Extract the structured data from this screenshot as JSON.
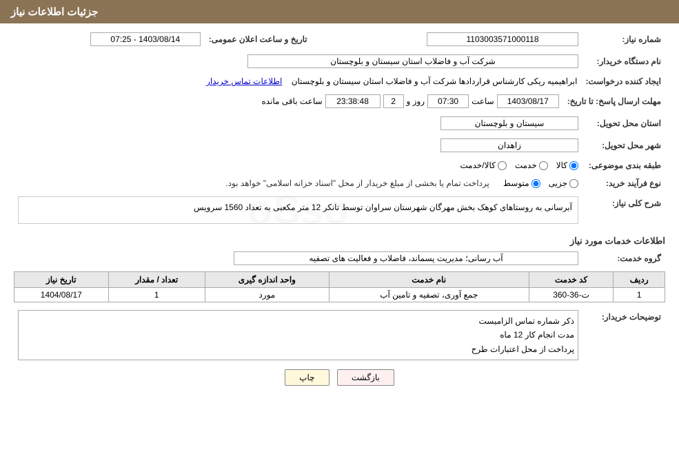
{
  "header": {
    "title": "جزئیات اطلاعات نیاز"
  },
  "fields": {
    "need_number_label": "شماره نیاز:",
    "need_number_value": "1103003571000118",
    "buyer_org_label": "نام دستگاه خریدار:",
    "buyer_org_value": "شرکت آب و فاضلاب استان سیستان و بلوچستان",
    "creator_label": "ایجاد کننده درخواست:",
    "creator_value": "ابراهیمیه ریکی کارشناس قراردادها شرکت آب و فاضلاب استان سیستان و بلوچستان",
    "contact_link": "اطلاعات تماس خریدار",
    "deadline_label": "مهلت ارسال پاسخ: تا تاریخ:",
    "deadline_date": "1403/08/17",
    "deadline_time_label": "ساعت",
    "deadline_time": "07:30",
    "deadline_day_label": "روز و",
    "deadline_days": "2",
    "deadline_remaining_label": "ساعت باقی مانده",
    "deadline_remaining": "23:38:48",
    "announce_label": "تاریخ و ساعت اعلان عمومی:",
    "announce_value": "1403/08/14 - 07:25",
    "province_label": "استان محل تحویل:",
    "province_value": "سیستان و بلوچستان",
    "city_label": "شهر محل تحویل:",
    "city_value": "زاهدان",
    "category_label": "طبقه بندی موضوعی:",
    "category_options": [
      "کالا",
      "خدمت",
      "کالا/خدمت"
    ],
    "category_selected": "کالا",
    "process_label": "نوع فرآیند خرید:",
    "process_options": [
      "جزیی",
      "متوسط",
      "پرداخت تام..."
    ],
    "process_note": "پرداخت تمام یا بخشی از مبلغ خریدار از محل \"اسناد خزانه اسلامی\" خواهد بود.",
    "description_label": "شرح کلی نیاز:",
    "description_value": "آبرسانی به روستاهای کوهک بخش مهرگان شهرستان سراوان توسط تانکر 12 متر مکعبی به تعداد 1560 سرویس",
    "service_info_title": "اطلاعات خدمات مورد نیاز",
    "service_group_label": "گروه خدمت:",
    "service_group_value": "آب رسانی؛ مدیریت پسماند، فاضلاب و فعالیت های تصفیه",
    "table_headers": [
      "ردیف",
      "کد خدمت",
      "نام خدمت",
      "واحد اندازه گیری",
      "تعداد / مقدار",
      "تاریخ نیاز"
    ],
    "table_rows": [
      {
        "row": "1",
        "code": "ت-36-360",
        "name": "جمع آوری، تصفیه و تامین آب",
        "unit": "مورد",
        "quantity": "1",
        "date": "1404/08/17"
      }
    ],
    "buyer_notes_label": "توضیحات خریدار:",
    "buyer_notes_lines": [
      "ذکر شماره تماس الزامیست",
      "مدت انجام کار 12 ماه",
      "پرداخت از محل اعتبارات طرح"
    ],
    "btn_print": "چاپ",
    "btn_back": "بازگشت"
  }
}
